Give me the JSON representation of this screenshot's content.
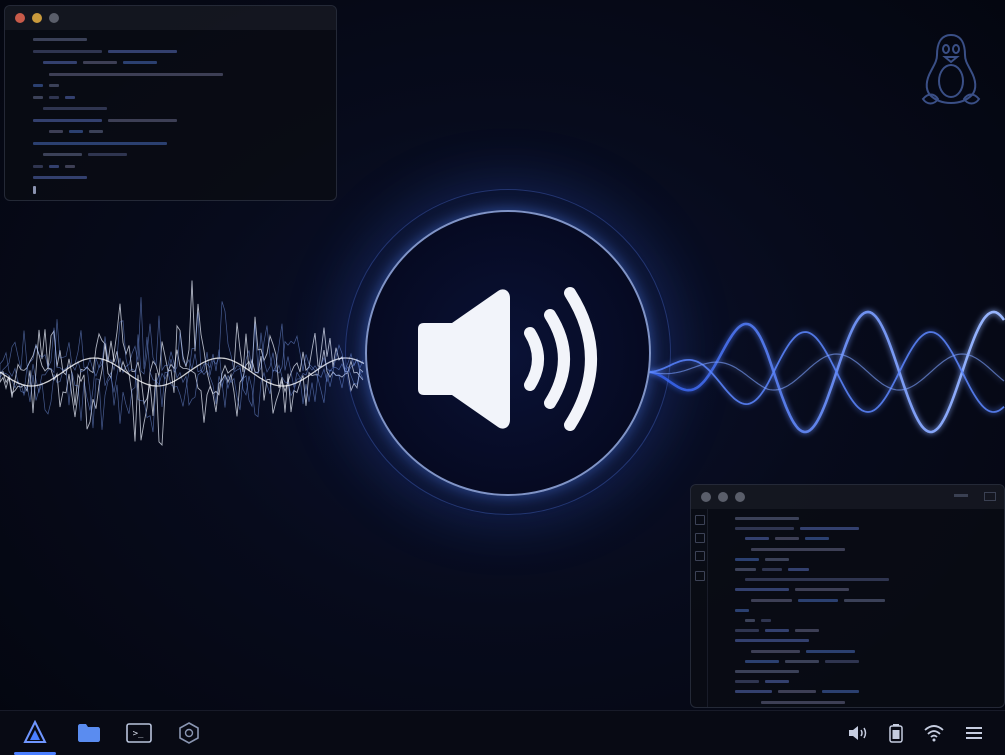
{
  "colors": {
    "wave_blue": "#4f7dff",
    "wave_glow": "#8fb0ff",
    "speaker_fill": "#f2f4fa",
    "taskbar_bg": "#080a14",
    "accent": "#4a7fff",
    "dot_red": "#c85b4a",
    "dot_yellow": "#c99a3c",
    "dot_gray": "#5a5e6a"
  },
  "desktop": {
    "logo_icon": "tux-penguin-icon",
    "center_icon": "volume-speaker-icon",
    "visualization": "audio-waveform"
  },
  "windows": [
    {
      "name": "code-editor-window-top-left",
      "line_count": 13
    },
    {
      "name": "code-editor-window-bottom-right",
      "line_count": 19
    }
  ],
  "taskbar": {
    "left_icons": [
      "app-launcher-icon",
      "file-manager-icon",
      "terminal-icon",
      "settings-hexagon-icon"
    ],
    "right_icons": [
      "volume-icon",
      "battery-icon",
      "wifi-icon",
      "menu-icon"
    ],
    "terminal_glyph": ">_"
  }
}
